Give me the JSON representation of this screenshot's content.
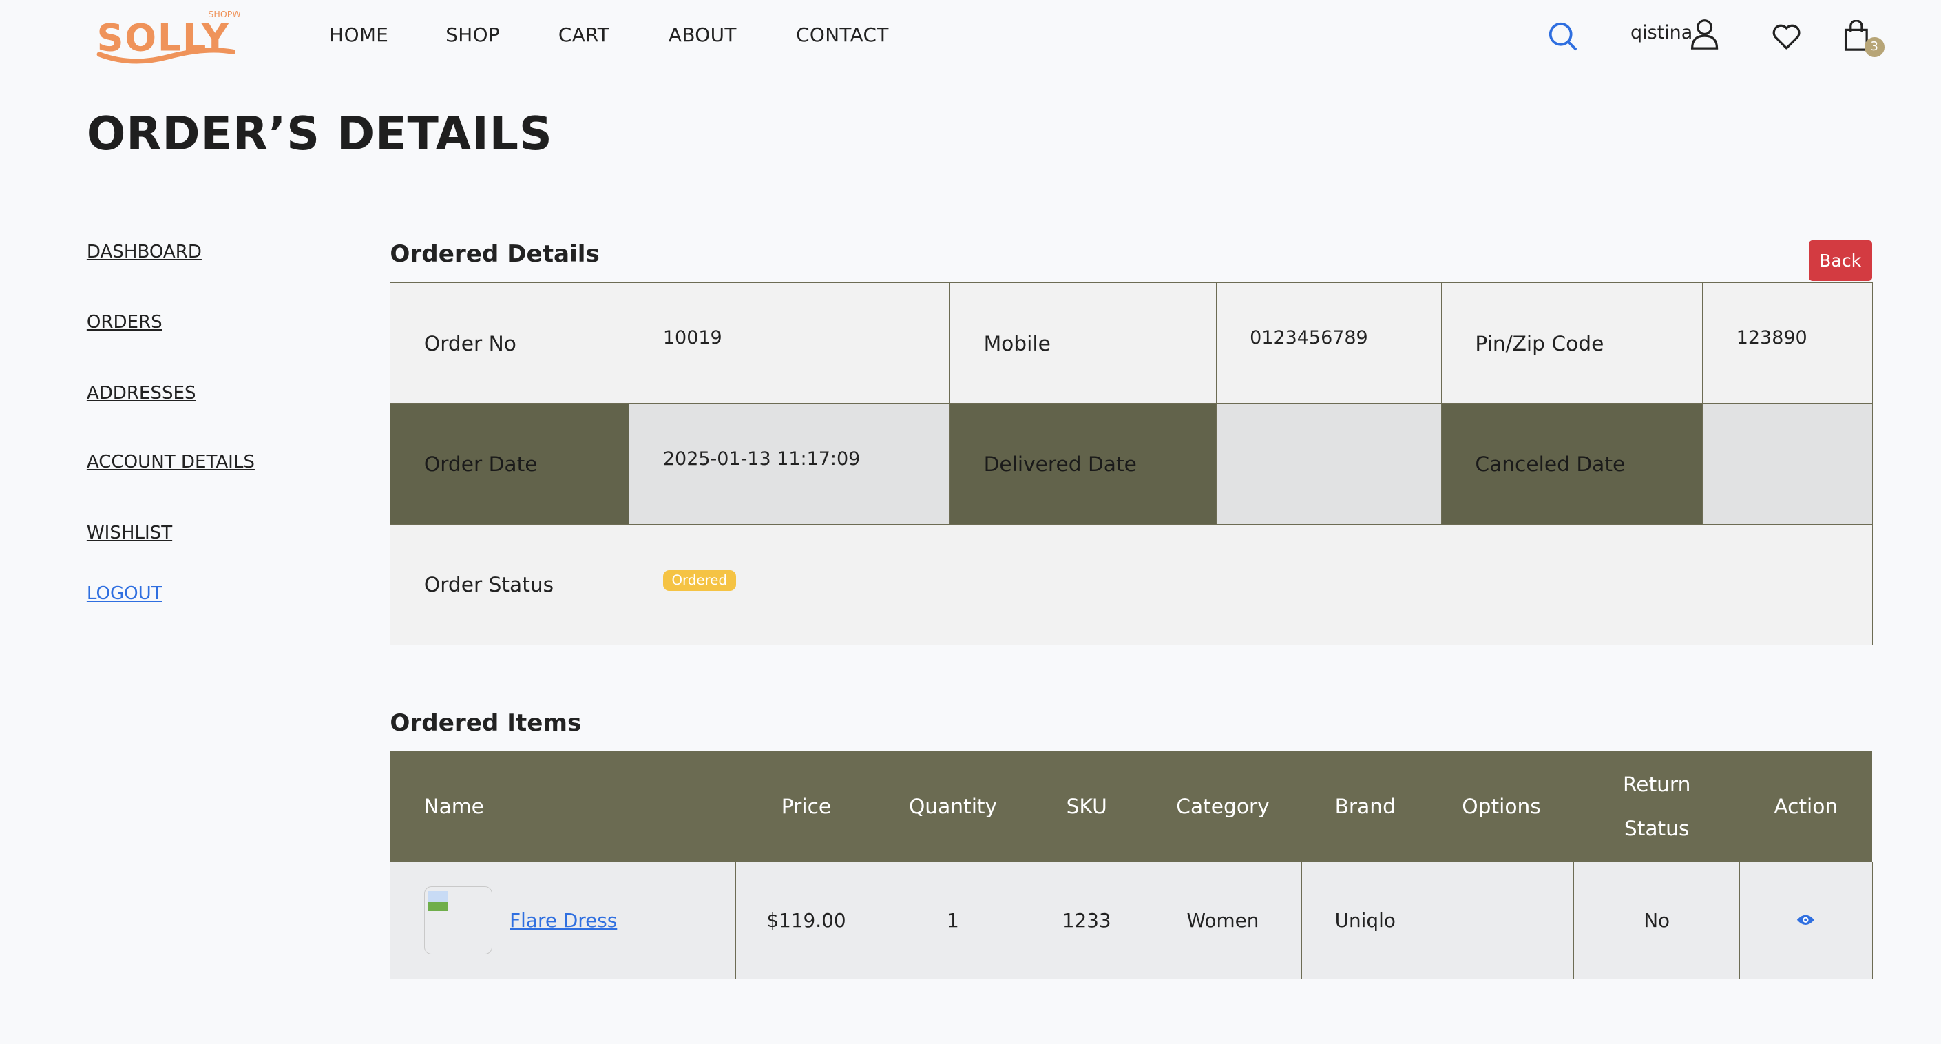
{
  "brand": {
    "logo_text": "SOLLY",
    "logo_sub": "SHOPWE",
    "logo_color": "#ef935a"
  },
  "nav": {
    "items": [
      "HOME",
      "SHOP",
      "CART",
      "ABOUT",
      "CONTACT"
    ]
  },
  "header": {
    "username": "qistina",
    "cart_count": "3",
    "icons": [
      "search-icon",
      "user-icon",
      "heart-icon",
      "shopping-bag-icon"
    ]
  },
  "page": {
    "title": "ORDER’S DETAILS"
  },
  "sidebar": {
    "items": [
      "DASHBOARD",
      "ORDERS",
      "ADDRESSES",
      "ACCOUNT DETAILS",
      "WISHLIST",
      "LOGOUT"
    ]
  },
  "details": {
    "heading": "Ordered Details",
    "back_label": "Back",
    "order_no_label": "Order No",
    "order_no": "10019",
    "mobile_label": "Mobile",
    "mobile": "0123456789",
    "zip_label": "Pin/Zip Code",
    "zip": "123890",
    "order_date_label": "Order Date",
    "order_date": "2025-01-13 11:17:09",
    "delivered_label": "Delivered Date",
    "delivered": "",
    "canceled_label": "Canceled Date",
    "canceled": "",
    "status_label": "Order Status",
    "status": "Ordered",
    "status_color": "#f5c344"
  },
  "items": {
    "heading": "Ordered Items",
    "columns": [
      "Name",
      "Price",
      "Quantity",
      "SKU",
      "Category",
      "Brand",
      "Options",
      "Return Status",
      "Action"
    ],
    "rows": [
      {
        "name": "Flare Dress",
        "price": "$119.00",
        "quantity": "1",
        "sku": "1233",
        "category": "Women",
        "brand": "Uniqlo",
        "options": "",
        "return_status": "No",
        "action_icon": "eye-icon"
      }
    ]
  }
}
